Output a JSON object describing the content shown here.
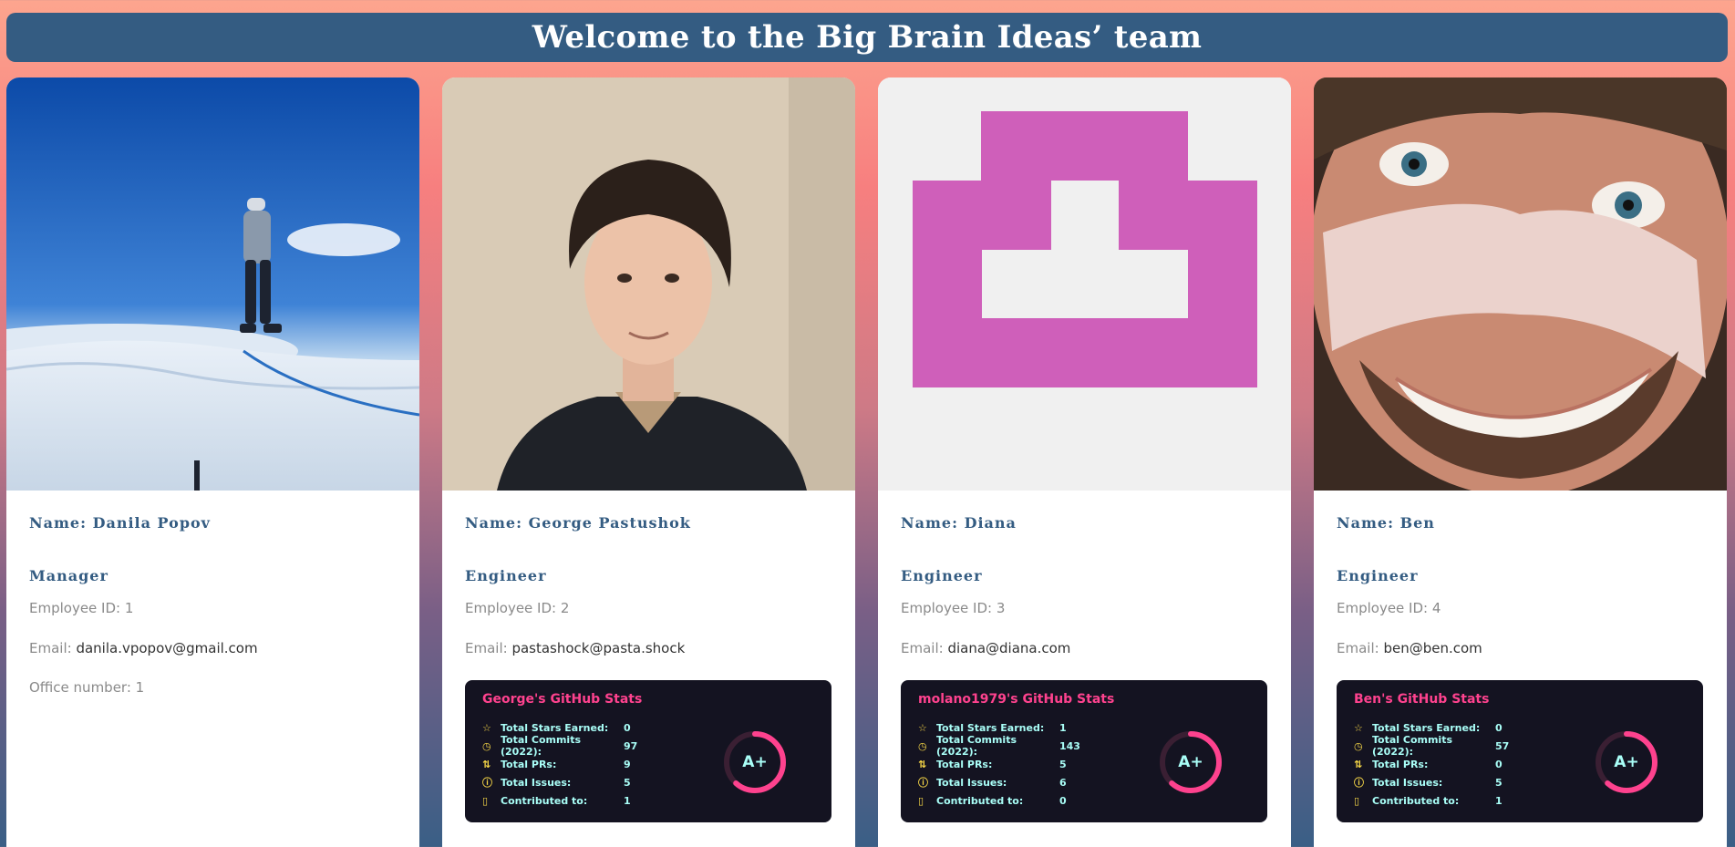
{
  "title": "Welcome to the Big Brain Ideas’ team",
  "labels": {
    "name_prefix": "Name: ",
    "id_prefix": "Employee ID: ",
    "email_prefix": "Email: ",
    "office_prefix": "Office number: ",
    "stars": "Total Stars Earned:",
    "commits": "Total Commits (2022):",
    "prs": "Total PRs:",
    "issues": "Total Issues:",
    "contrib": "Contributed to:"
  },
  "icons": {
    "stars": "star-icon",
    "commits": "history-icon",
    "prs": "pull-request-icon",
    "issues": "issue-icon",
    "contrib": "repo-icon"
  },
  "colors": {
    "banner": "#345c82",
    "stats_bg": "#141321",
    "stats_title": "#fe428e",
    "stats_text": "#a9fef7",
    "stats_icon": "#f8d847",
    "identicon": "#cf5fba"
  },
  "employees": [
    {
      "name": "Danila Popov",
      "role": "Manager",
      "id": "1",
      "email": "danila.vpopov@gmail.com",
      "office": "1",
      "photo": "mountaineer-photo"
    },
    {
      "name": "George Pastushok",
      "role": "Engineer",
      "id": "2",
      "email": "pastashock@pasta.shock",
      "photo": "portrait-photo",
      "github": {
        "title": "George's GitHub Stats",
        "stars": "0",
        "commits": "97",
        "prs": "9",
        "issues": "5",
        "contrib": "1",
        "grade": "A+"
      }
    },
    {
      "name": "Diana",
      "role": "Engineer",
      "id": "3",
      "email": "diana@diana.com",
      "photo": "identicon-avatar",
      "github": {
        "title": "molano1979's GitHub Stats",
        "stars": "1",
        "commits": "143",
        "prs": "5",
        "issues": "6",
        "contrib": "0",
        "grade": "A+"
      }
    },
    {
      "name": "Ben",
      "role": "Engineer",
      "id": "4",
      "email": "ben@ben.com",
      "photo": "masked-face-photo",
      "github": {
        "title": "Ben's GitHub Stats",
        "stars": "0",
        "commits": "57",
        "prs": "0",
        "issues": "5",
        "contrib": "1",
        "grade": "A+"
      }
    }
  ]
}
